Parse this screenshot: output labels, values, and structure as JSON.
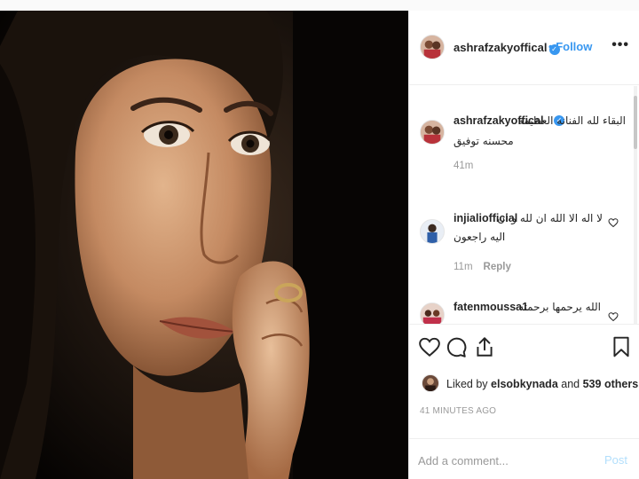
{
  "post": {
    "author": "ashrafzakyoffical",
    "follow_label": "Follow",
    "dot": "•",
    "more_label": "•••"
  },
  "comments": [
    {
      "user": "ashrafzakyoffical",
      "text_line1": "البقاء لله الفنانه العظيمه",
      "text_line2": "محسنه توفيق",
      "time": "41m",
      "reply": ""
    },
    {
      "user": "injialiofficial",
      "text_line1": "لا اله الا الله ان لله و ان",
      "text_line2": "اليه راجعون",
      "time": "11m",
      "reply": "Reply"
    },
    {
      "user": "fatenmoussa1",
      "text_line1": "الله يرحمها برحمته",
      "text_line2": "",
      "time": "",
      "reply": ""
    }
  ],
  "likes": {
    "prefix": "Liked by",
    "user": "elsobkynada",
    "middle": "and",
    "others": "539 others"
  },
  "time_ago": "41 MINUTES AGO",
  "add_comment": {
    "placeholder": "Add a comment...",
    "post_label": "Post"
  },
  "icons": {
    "like": "heart-icon",
    "comment": "comment-icon",
    "share": "share-icon",
    "save": "bookmark-icon",
    "more": "more-options-icon",
    "verified": "verified-badge-icon"
  },
  "colors": {
    "link_blue": "#3897f0",
    "muted": "#999999",
    "post_disabled": "#b2dffc",
    "text": "#262626"
  }
}
